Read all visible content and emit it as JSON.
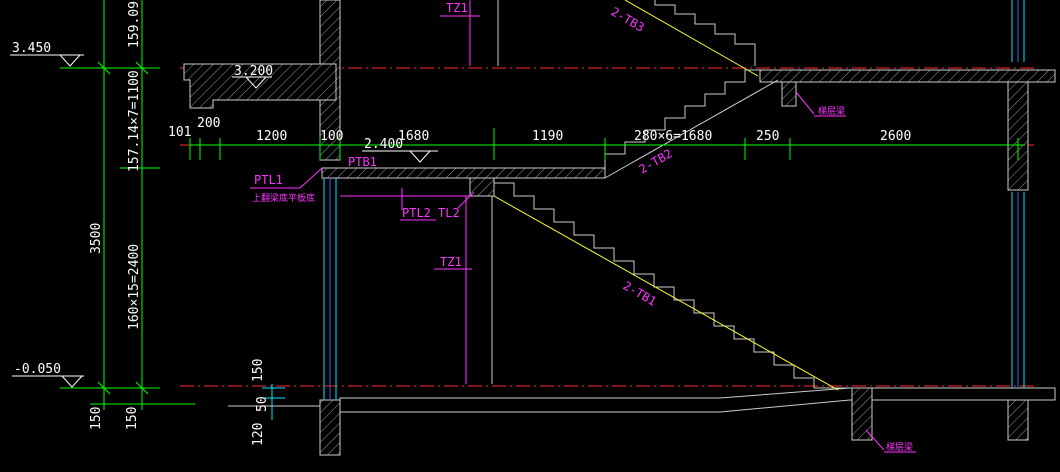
{
  "colors": {
    "background": "#000000",
    "dim_line": "#00ff00",
    "wall": "#cccccc",
    "axis": "#ff2a2a",
    "stair_line": "#ffff33",
    "label": "#ff33ff",
    "column": "#00e5ff",
    "text": "#ffffff"
  },
  "elevations": {
    "top": "3.450",
    "landing": "3.200",
    "mid": "2.400",
    "bottom": "-0.050"
  },
  "vertical_dims": {
    "upper_total": "159.09",
    "upper_steps": "157.14×7=1100",
    "total": "3500",
    "lower_steps": "160×15=2400",
    "left_bottom_a": "150",
    "left_bottom_b": "150",
    "right_small_top": "150",
    "right_small_mid": "50",
    "right_small_bottom": "120"
  },
  "horizontal_dims": {
    "d101": "101",
    "d200": "200",
    "d1200": "1200",
    "d100": "100",
    "d1680": "1680",
    "d1190": "1190",
    "d_run": "280×6=1680",
    "d250": "250",
    "d2600": "2600"
  },
  "labels": {
    "tz1_top": "TZ1",
    "tz1_mid": "TZ1",
    "tb3": "2-TB3",
    "tb2": "2-TB2",
    "tb1": "2-TB1",
    "ptl1": "PTL1",
    "ptl1_note": "上翻梁底平板底",
    "ptb1": "PTB1",
    "ptl2": "PTL2",
    "tl2": "TL2",
    "beam_note_top": "梯层梁",
    "beam_note_bottom": "梯层梁"
  }
}
